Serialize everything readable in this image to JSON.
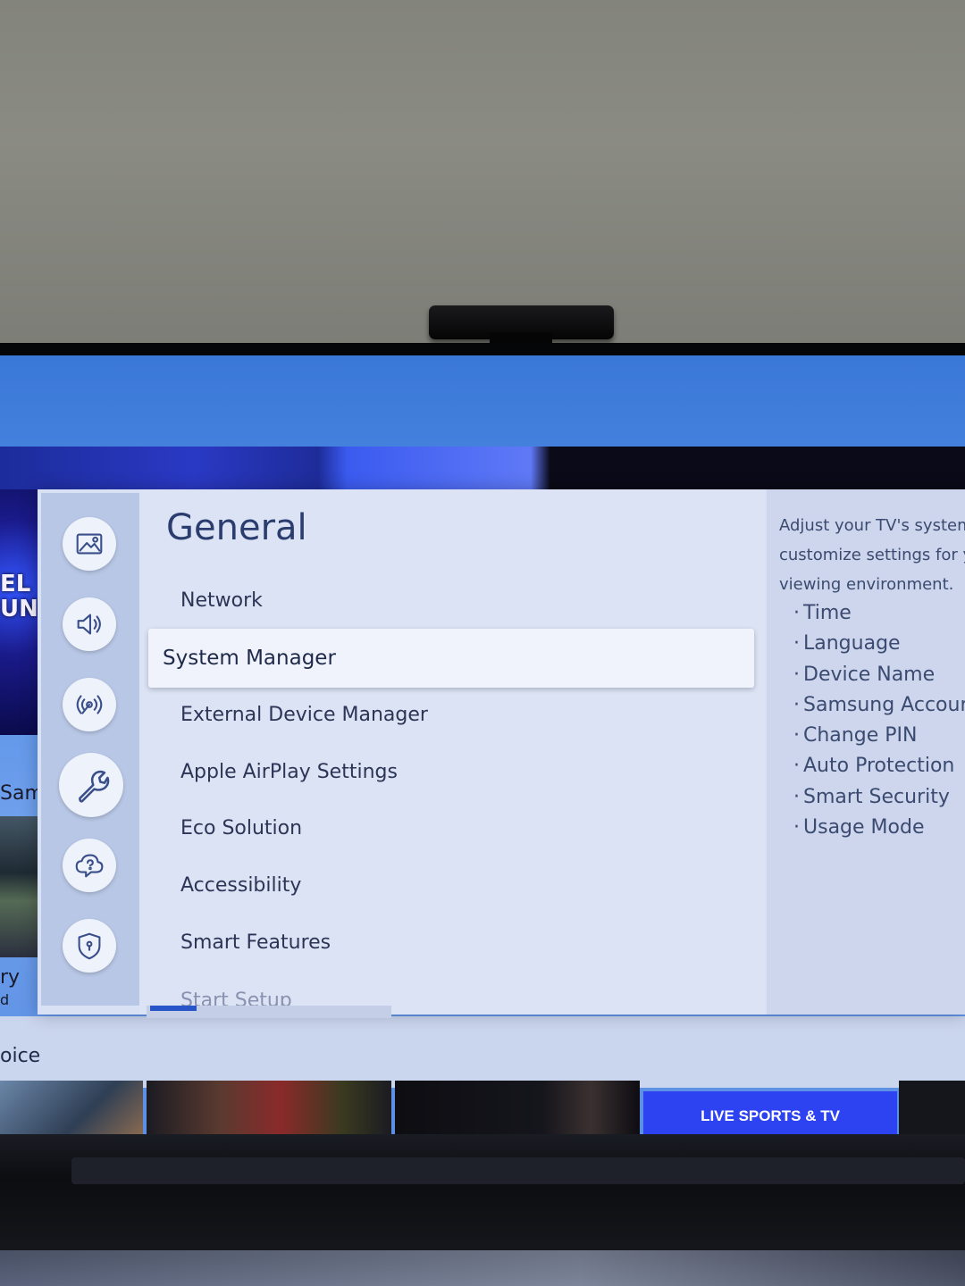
{
  "settings": {
    "category_title": "General",
    "menu_items": [
      {
        "label": "Network"
      },
      {
        "label": "System Manager"
      },
      {
        "label": "External Device Manager"
      },
      {
        "label": "Apple AirPlay Settings"
      },
      {
        "label": "Eco Solution"
      },
      {
        "label": "Accessibility"
      },
      {
        "label": "Smart Features"
      },
      {
        "label": "Start Setup"
      }
    ],
    "selected_item": "System Manager",
    "rail_icons": [
      "picture-icon",
      "sound-icon",
      "broadcasting-icon",
      "general-wrench-icon",
      "support-icon",
      "privacy-shield-icon"
    ],
    "active_rail_icon": "general-wrench-icon",
    "description": {
      "text": "Adjust your TV's system customize settings for y viewing environment.",
      "line1": "Adjust your TV's system",
      "line2": "customize settings for y",
      "line3": "viewing environment.",
      "items": [
        "Time",
        "Language",
        "Device Name",
        "Samsung Accour",
        "Change PIN",
        "Auto Protection",
        "Smart Security",
        "Usage Mode"
      ]
    }
  },
  "background": {
    "promo_text_1": "EL",
    "promo_text_2": "UN",
    "side_text_1": "Sam",
    "side_text_2": "ry",
    "side_text_3": "d",
    "voice_fragment": "oice",
    "live_tile_label": "LIVE SPORTS & TV"
  },
  "colors": {
    "panel_bg": "#d9e2f4",
    "rail_bg": "#b8c7e6",
    "selected_bg": "#f0f3fb",
    "title_color": "#2b3d6e",
    "accent": "#2856c8"
  }
}
